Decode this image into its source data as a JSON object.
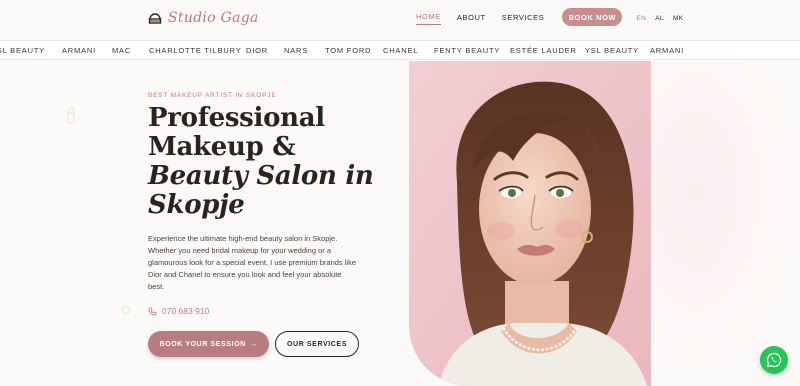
{
  "header": {
    "logo_text": "Studio Gaga",
    "nav": [
      {
        "label": "HOME",
        "active": true
      },
      {
        "label": "ABOUT",
        "active": false
      },
      {
        "label": "SERVICES",
        "active": false
      }
    ],
    "book_label": "BOOK NOW",
    "languages": [
      {
        "label": "EN",
        "active": true
      },
      {
        "label": "AL",
        "active": false
      },
      {
        "label": "MK",
        "active": false
      }
    ]
  },
  "brands": [
    "YSL BEAUTY",
    "ARMANI",
    "MAC",
    "CHARLOTTE TILBURY",
    "DIOR",
    "NARS",
    "TOM FORD",
    "CHANEL",
    "FENTY BEAUTY",
    "ESTÉE LAUDER",
    "YSL BEAUTY",
    "ARMANI"
  ],
  "hero": {
    "eyebrow": "BEST MAKEUP ARTIST IN SKOPJE",
    "title_line1": "Professional",
    "title_line2": "Makeup &",
    "title_line3": "Beauty Salon in",
    "title_line4": "Skopje",
    "description": "Experience the ultimate high-end beauty salon in Skopje. Whether you need bridal makeup for your wedding or a glamourous look for a special event, I use premium brands like Dior and Chanel to ensure you look and feel your absolute best.",
    "phone": "070 683 910",
    "cta_primary": "BOOK YOUR SESSION",
    "cta_primary_arrow": "→",
    "cta_secondary": "OUR SERVICES"
  },
  "colors": {
    "accent": "#b87d80",
    "background": "#fcfaf8",
    "whatsapp": "#29c35b"
  },
  "icons": {
    "logo": "mirror-icon",
    "phone": "phone-icon",
    "whatsapp": "whatsapp-icon"
  }
}
